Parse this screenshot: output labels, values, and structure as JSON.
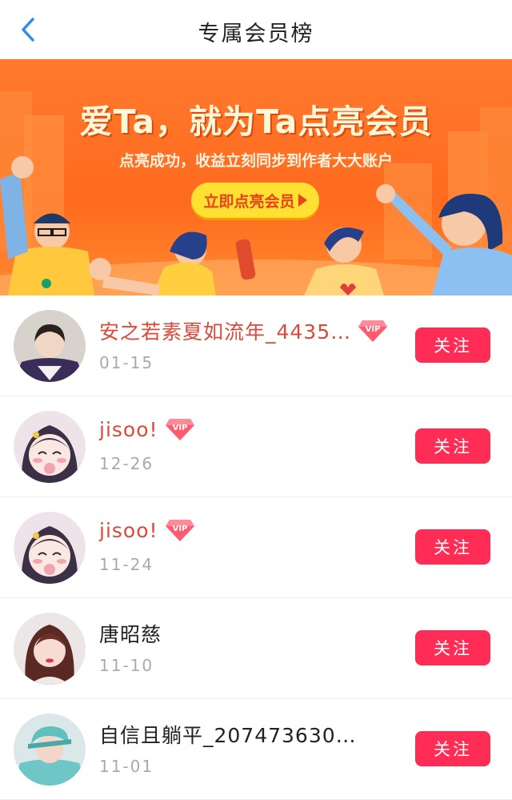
{
  "header": {
    "title": "专属会员榜",
    "back_icon": "chevron-left-icon"
  },
  "banner": {
    "headline": "爱Ta，就为Ta点亮会员",
    "subtitle": "点亮成功，收益立刻同步到作者大大账户",
    "cta_label": "立即点亮会员",
    "colors": {
      "bg": "#ff6a1e",
      "cta_bg": "#ffe033",
      "cta_text": "#e8431a"
    }
  },
  "members": [
    {
      "name": "安之若素夏如流年_4435…",
      "date": "01-15",
      "vip": true,
      "follow_label": "关注",
      "avatar": "avatar-boy"
    },
    {
      "name": "jisoo!",
      "date": "12-26",
      "vip": true,
      "follow_label": "关注",
      "avatar": "avatar-anime-girl"
    },
    {
      "name": "jisoo!",
      "date": "11-24",
      "vip": true,
      "follow_label": "关注",
      "avatar": "avatar-anime-girl"
    },
    {
      "name": "唐昭慈",
      "date": "11-10",
      "vip": false,
      "follow_label": "关注",
      "avatar": "avatar-girl-red"
    },
    {
      "name": "自信且躺平_207473630…",
      "date": "11-01",
      "vip": false,
      "follow_label": "关注",
      "avatar": "avatar-girl-teal"
    }
  ],
  "vip_badge_text": "VIP",
  "colors": {
    "follow_bg": "#ff2d55",
    "vip_name": "#d94a3a",
    "date": "#aaaaaa",
    "back": "#2d8cf0"
  }
}
